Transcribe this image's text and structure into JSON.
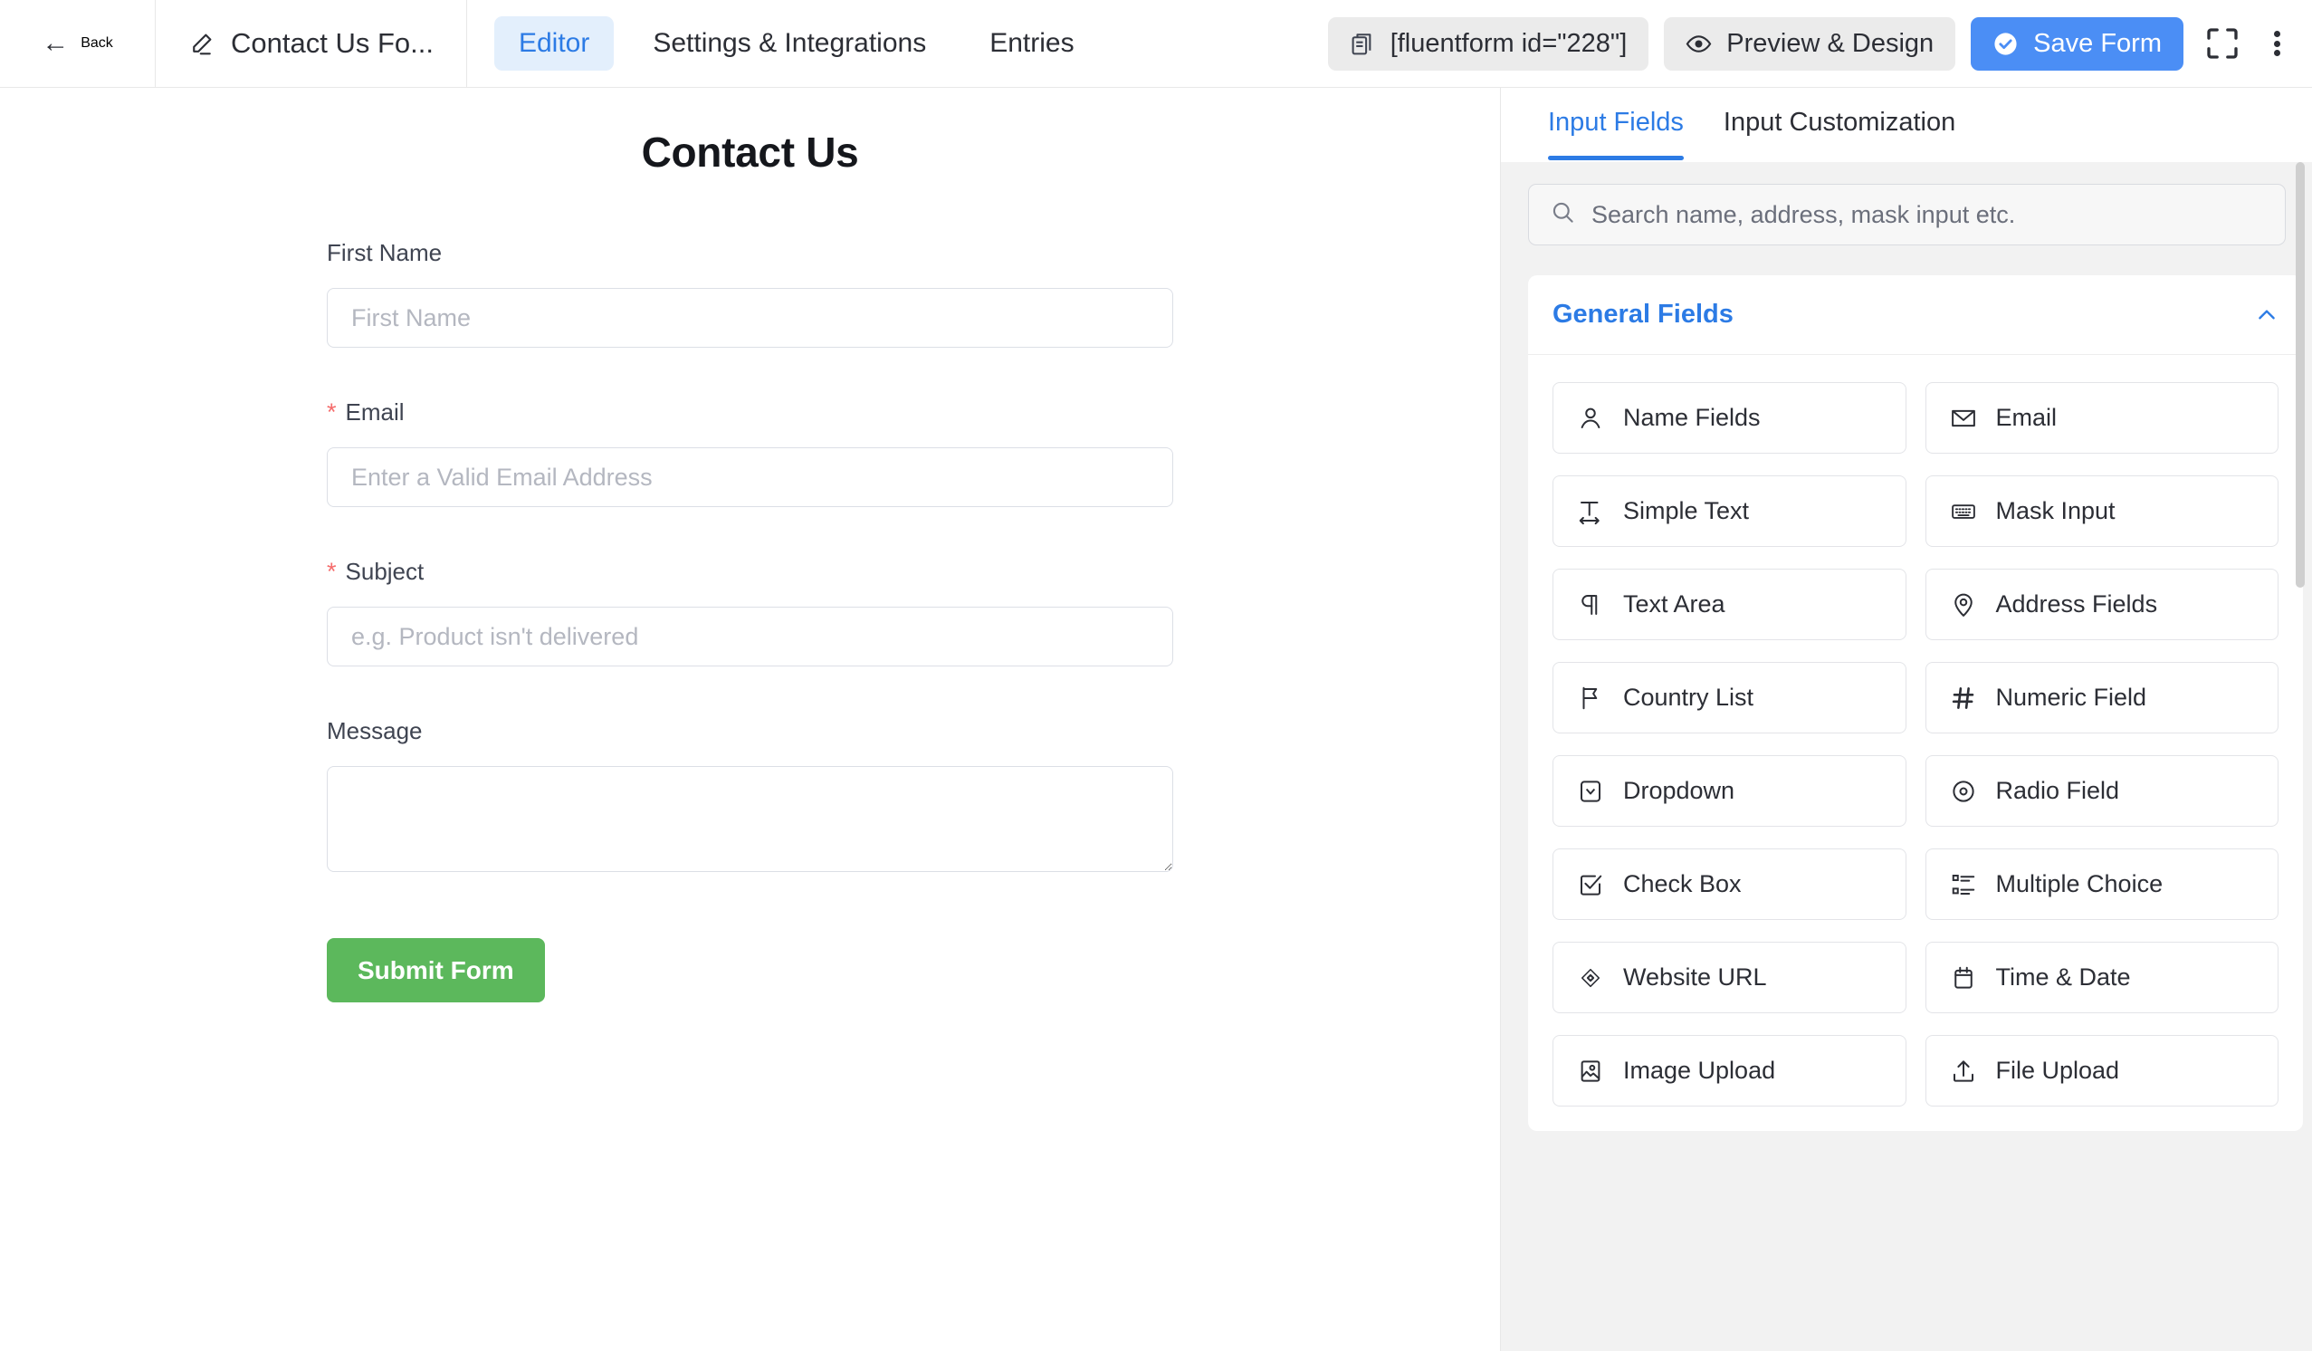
{
  "topbar": {
    "back_label": "Back",
    "back_icon": "arrow-left-icon",
    "form_title": "Contact Us Fo...",
    "form_title_icon": "pencil-icon",
    "tabs": [
      {
        "label": "Editor",
        "active": true
      },
      {
        "label": "Settings & Integrations",
        "active": false
      },
      {
        "label": "Entries",
        "active": false
      }
    ],
    "shortcode": {
      "label": "[fluentform id=\"228\"]",
      "icon": "copy-icon"
    },
    "preview": {
      "label": "Preview & Design",
      "icon": "eye-icon"
    },
    "save": {
      "label": "Save Form",
      "icon": "check-circle-icon"
    },
    "expand_icon": "fullscreen-icon",
    "more_icon": "kebab-menu-icon"
  },
  "form": {
    "heading": "Contact Us",
    "fields": [
      {
        "label": "First Name",
        "required": false,
        "placeholder": "First Name",
        "type": "text"
      },
      {
        "label": "Email",
        "required": true,
        "placeholder": "Enter a Valid Email Address",
        "type": "text"
      },
      {
        "label": "Subject",
        "required": true,
        "placeholder": "e.g. Product isn't delivered",
        "type": "text"
      },
      {
        "label": "Message",
        "required": false,
        "placeholder": "",
        "type": "textarea"
      }
    ],
    "required_marker": "*",
    "submit_label": "Submit Form",
    "submit_color": "#5cb85c"
  },
  "panel": {
    "tabs": [
      {
        "label": "Input Fields",
        "active": true
      },
      {
        "label": "Input Customization",
        "active": false
      }
    ],
    "accent_color": "#2c7be5",
    "search": {
      "placeholder": "Search name, address, mask input etc.",
      "value": "",
      "icon": "search-icon"
    },
    "group": {
      "title": "General Fields",
      "collapse_icon": "chevron-up-icon",
      "expanded": true,
      "items": [
        {
          "label": "Name Fields",
          "icon": "user-icon"
        },
        {
          "label": "Email",
          "icon": "envelope-icon"
        },
        {
          "label": "Simple Text",
          "icon": "text-width-icon"
        },
        {
          "label": "Mask Input",
          "icon": "keyboard-icon"
        },
        {
          "label": "Text Area",
          "icon": "paragraph-icon"
        },
        {
          "label": "Address Fields",
          "icon": "map-pin-icon"
        },
        {
          "label": "Country List",
          "icon": "flag-icon"
        },
        {
          "label": "Numeric Field",
          "icon": "hash-icon"
        },
        {
          "label": "Dropdown",
          "icon": "caret-square-down-icon"
        },
        {
          "label": "Radio Field",
          "icon": "radio-circle-icon"
        },
        {
          "label": "Check Box",
          "icon": "check-square-icon"
        },
        {
          "label": "Multiple Choice",
          "icon": "list-icon"
        },
        {
          "label": "Website URL",
          "icon": "link-diamond-icon"
        },
        {
          "label": "Time & Date",
          "icon": "calendar-icon"
        },
        {
          "label": "Image Upload",
          "icon": "image-icon"
        },
        {
          "label": "File Upload",
          "icon": "upload-icon"
        }
      ]
    }
  }
}
